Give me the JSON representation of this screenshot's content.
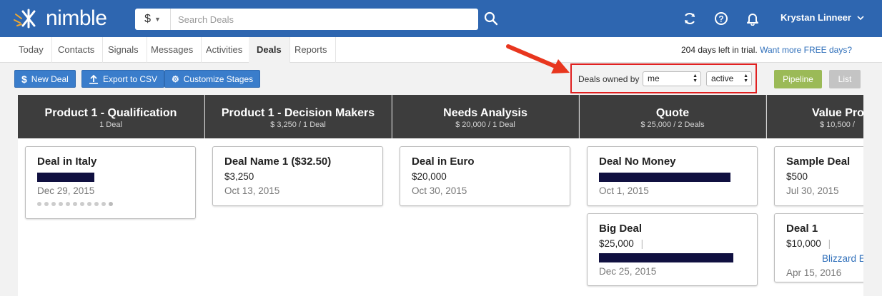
{
  "app": {
    "logo_text": "nimble"
  },
  "search": {
    "type_symbol": "$",
    "placeholder": "Search Deals"
  },
  "user": {
    "name": "Krystan Linneer"
  },
  "nav": {
    "tabs": [
      "Today",
      "Contacts",
      "Signals",
      "Messages",
      "Activities",
      "Deals",
      "Reports"
    ],
    "active": "Deals"
  },
  "trial": {
    "text": "204 days left in trial.",
    "link": "Want more FREE days?"
  },
  "toolbar": {
    "new_deal": "New Deal",
    "export": "Export to CSV",
    "customize": "Customize Stages",
    "owned_label": "Deals owned by",
    "owner_value": "me",
    "status_value": "active",
    "pipeline": "Pipeline",
    "list": "List"
  },
  "columns": [
    {
      "title": "Product 1 - Qualification",
      "subtitle": "1 Deal",
      "cards": [
        {
          "title": "Deal in Italy",
          "value": "",
          "date": "Dec 29, 2015"
        }
      ]
    },
    {
      "title": "Product 1 - Decision Makers",
      "subtitle": "$ 3,250 / 1 Deal",
      "cards": [
        {
          "title": "Deal Name 1 ($32.50)",
          "value": "$3,250",
          "date": "Oct 13, 2015"
        }
      ]
    },
    {
      "title": "Needs Analysis",
      "subtitle": "$ 20,000 / 1 Deal",
      "cards": [
        {
          "title": "Deal in Euro",
          "value": "$20,000",
          "date": "Oct 30, 2015"
        }
      ]
    },
    {
      "title": "Quote",
      "subtitle": "$ 25,000 / 2 Deals",
      "cards": [
        {
          "title": "Deal No Money",
          "value": "",
          "date": "Oct 1, 2015"
        },
        {
          "title": "Big Deal",
          "value": "$25,000",
          "date": "Dec 25, 2015"
        }
      ]
    },
    {
      "title": "Value Pro",
      "subtitle": "$ 10,500 /",
      "cards": [
        {
          "title": "Sample Deal",
          "value": "$500",
          "date": "Jul 30, 2015"
        },
        {
          "title": "Deal 1",
          "value": "$10,000",
          "company": "Blizzard E",
          "date": "Apr 15, 2016"
        }
      ]
    }
  ],
  "colors": {
    "topbar": "#2e66b0",
    "button_blue": "#3a7dcb",
    "pipeline_green": "#9bba57",
    "highlight_red": "#e02020"
  }
}
